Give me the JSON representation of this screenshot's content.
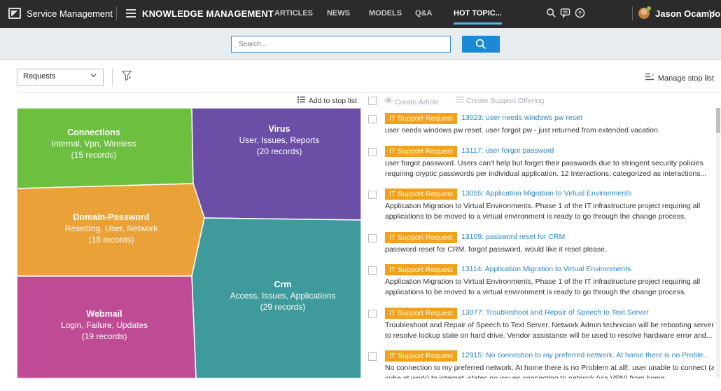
{
  "topbar": {
    "brand": "Service Management",
    "module": "KNOWLEDGE MANAGEMENT",
    "nav": [
      "ARTICLES",
      "NEWS",
      "MODELS",
      "Q&A",
      "HOT TOPIC..."
    ],
    "user": "Jason Ocampo"
  },
  "search": {
    "placeholder": "Search..."
  },
  "filter": {
    "dropdown_value": "Requests",
    "manage_label": "Manage stop list"
  },
  "actions": {
    "add_stop": "Add to stop list",
    "create_article": "Create Article",
    "create_offering": "Create Support Offering"
  },
  "treemap": [
    {
      "name": "Connections",
      "terms": "Internal, Vpn, Wireless",
      "count": "(15 records)",
      "color": "#6cbf3f"
    },
    {
      "name": "Virus",
      "terms": "User, Issues, Reports",
      "count": "(20 records)",
      "color": "#6b4ea6"
    },
    {
      "name": "Domain-Password",
      "terms": "Resetting, User, Network",
      "count": "(18 records)",
      "color": "#eaa137"
    },
    {
      "name": "Crm",
      "terms": "Access, Issues, Applications",
      "count": "(29 records)",
      "color": "#3f9b9b"
    },
    {
      "name": "Webmail",
      "terms": "Login, Failure, Updates",
      "count": "(19 records)",
      "color": "#be4b93"
    }
  ],
  "list": [
    {
      "tag": "IT Support Request",
      "title": "13023:  user needs windows pw reset",
      "desc": "user needs windows pw reset. user forgot pw - just returned from extended vacation."
    },
    {
      "tag": "IT Support Request",
      "title": "13117:  user forgot password",
      "desc": "user forgot password. Users can't help but forget their passwords due to stringent security policies requiring cryptic passwords per individual application. 12 Interactions, categorized as interactions..."
    },
    {
      "tag": "IT Support Request",
      "title": "13055:  Application Migration to Virtual Environments",
      "desc": "Application Migration to Virtual Environments. Phase 1 of the IT infrastructure project requiring all applications to be moved to a virtual environment is ready to go through the change process."
    },
    {
      "tag": "IT Support Request",
      "title": "13109:  password reset for CRM",
      "desc": "password reset for CRM. forgot password, would like it reset please."
    },
    {
      "tag": "IT Support Request",
      "title": "13114:  Application Migration to Virtual Environments",
      "desc": "Application Migration to Virtual Environments. Phase 1 of the IT infrastructure project requiring all applications to be moved to a virtual environment is ready to go through the change process."
    },
    {
      "tag": "IT Support Request",
      "title": "13077:  Troubleshoot and Repair of Speech to Text Server",
      "desc": "Troubleshoot and Repair of Speech to Text Server. Network Admin technician will be rebooting server to resolve lockup state on hard drive. Vendor assistance will be used to resolve hardware error and..."
    },
    {
      "tag": "IT Support Request",
      "title": "12915:  No connection to my preferred network. At home there is no Proble...",
      "desc": "No connection to my preferred network. At home there is no Problem at all!. user unable to connect (at cube at work) to internet. states no issues connecting to network (via VPN) from home."
    }
  ]
}
